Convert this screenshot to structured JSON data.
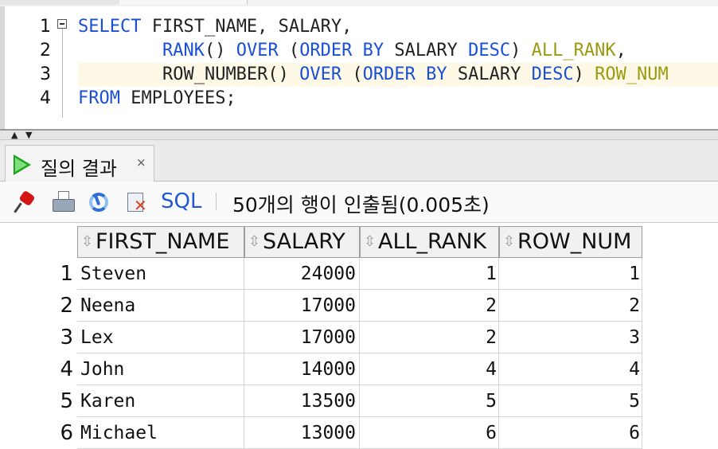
{
  "editor": {
    "lines": [
      {
        "num": "1",
        "tokens": [
          {
            "t": "SELECT",
            "c": "kw"
          },
          {
            "t": " FIRST_NAME, SALARY,",
            "c": ""
          }
        ]
      },
      {
        "num": "2",
        "tokens": [
          {
            "t": "        ",
            "c": ""
          },
          {
            "t": "RANK",
            "c": "kw"
          },
          {
            "t": "() ",
            "c": ""
          },
          {
            "t": "OVER",
            "c": "kw"
          },
          {
            "t": " (",
            "c": ""
          },
          {
            "t": "ORDER BY",
            "c": "kw"
          },
          {
            "t": " SALARY ",
            "c": ""
          },
          {
            "t": "DESC",
            "c": "kw"
          },
          {
            "t": ") ",
            "c": ""
          },
          {
            "t": "ALL_RANK",
            "c": "al"
          },
          {
            "t": ",",
            "c": ""
          }
        ]
      },
      {
        "num": "3",
        "tokens": [
          {
            "t": "        ",
            "c": ""
          },
          {
            "t": "ROW_NUMBER",
            "c": ""
          },
          {
            "t": "() ",
            "c": ""
          },
          {
            "t": "OVER",
            "c": "kw"
          },
          {
            "t": " (",
            "c": ""
          },
          {
            "t": "ORDER BY",
            "c": "kw"
          },
          {
            "t": " SALARY ",
            "c": ""
          },
          {
            "t": "DESC",
            "c": "kw"
          },
          {
            "t": ") ",
            "c": ""
          },
          {
            "t": "ROW_NUM",
            "c": "al"
          }
        ]
      },
      {
        "num": "4",
        "tokens": [
          {
            "t": "FROM",
            "c": "kw"
          },
          {
            "t": " EMPLOYEES;",
            "c": ""
          }
        ]
      }
    ],
    "highlighted_line": 3
  },
  "result_tab": {
    "label": "질의 결과",
    "close_glyph": "×"
  },
  "toolbar": {
    "sql_label": "SQL",
    "separator": "|",
    "status_text": "50개의 행이 인출됨(0.005초)"
  },
  "grid": {
    "sort_glyph": "⇳",
    "columns": [
      "FIRST_NAME",
      "SALARY",
      "ALL_RANK",
      "ROW_NUM"
    ],
    "rows": [
      {
        "n": "1",
        "cells": [
          "Steven",
          "24000",
          "1",
          "1"
        ]
      },
      {
        "n": "2",
        "cells": [
          "Neena",
          "17000",
          "2",
          "2"
        ]
      },
      {
        "n": "3",
        "cells": [
          "Lex",
          "17000",
          "2",
          "3"
        ]
      },
      {
        "n": "4",
        "cells": [
          "John",
          "14000",
          "4",
          "4"
        ]
      },
      {
        "n": "5",
        "cells": [
          "Karen",
          "13500",
          "5",
          "5"
        ]
      },
      {
        "n": "6",
        "cells": [
          "Michael",
          "13000",
          "6",
          "6"
        ]
      }
    ]
  },
  "colors": {
    "keyword": "#1a4fd6",
    "alias": "#9a9a12",
    "highlight_line": "#fdf9e6",
    "play_icon": "#1ea51e",
    "sql_link": "#2158d6"
  },
  "icons": [
    "pin-icon",
    "print-icon",
    "refresh-icon",
    "cancel-icon",
    "run-icon",
    "fold-icon"
  ]
}
